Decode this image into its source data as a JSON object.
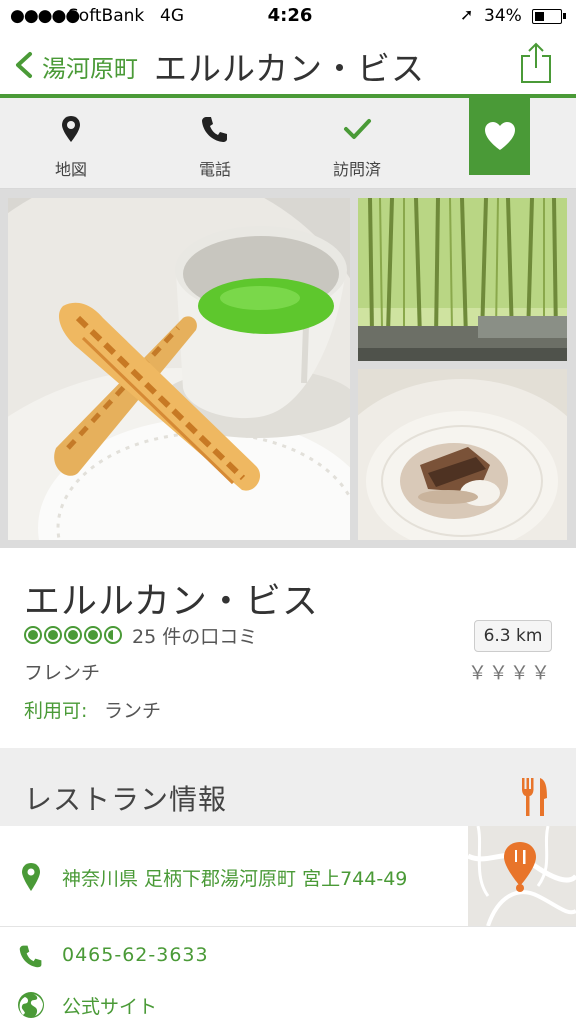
{
  "status_bar": {
    "signal": "●●●●●",
    "carrier": "SoftBank",
    "network": "4G",
    "time": "4:26",
    "battery": "34%"
  },
  "nav": {
    "back_label": "湯河原町",
    "title": "エルルカン・ビス",
    "icons": {
      "back": "chevron-left-icon",
      "share": "share-icon"
    }
  },
  "actions": [
    {
      "label": "地図",
      "icon": "map-pin-icon"
    },
    {
      "label": "電話",
      "icon": "phone-icon"
    },
    {
      "label": "訪問済",
      "icon": "check-icon"
    }
  ],
  "favorite": {
    "icon": "heart-icon"
  },
  "photos": [
    {
      "subject": "pastry sticks with green soup cup"
    },
    {
      "subject": "bamboo grove"
    },
    {
      "subject": "tiramisu dessert"
    }
  ],
  "restaurant": {
    "name": "エルルカン・ビス",
    "rating": 4.5,
    "reviews": "25 件の口コミ",
    "cuisine": "フレンチ",
    "availability_label": "利用可:",
    "availability_value": "ランチ",
    "distance": "6.3 km",
    "price": "￥￥￥￥"
  },
  "section": {
    "title": "レストラン情報",
    "icon": "fork-knife-icon"
  },
  "contact": {
    "address": "神奈川県 足柄下郡湯河原町 宮上744-49",
    "phone": "0465-62-3633",
    "website_label": "公式サイト"
  },
  "colors": {
    "accent": "#4a9a37",
    "section_bg": "#eeeeee",
    "orange": "#e8742a"
  }
}
